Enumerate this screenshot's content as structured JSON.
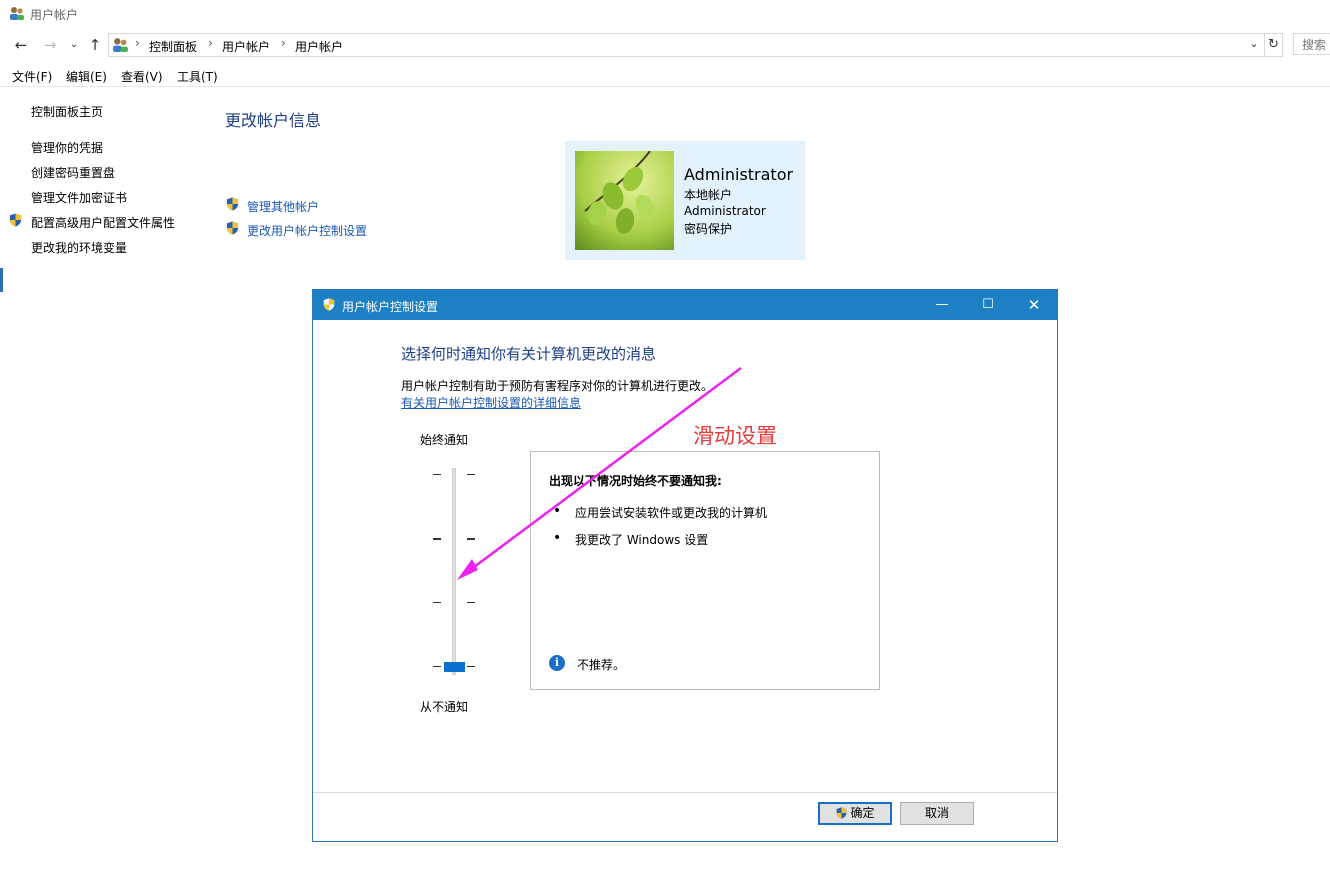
{
  "window": {
    "title": "用户帐户"
  },
  "nav": {
    "breadcrumb": [
      "控制面板",
      "用户帐户",
      "用户帐户"
    ],
    "search_placeholder": "搜索"
  },
  "menu": [
    "文件(F)",
    "编辑(E)",
    "查看(V)",
    "工具(T)"
  ],
  "sidebar": {
    "home": "控制面板主页",
    "items": [
      "管理你的凭据",
      "创建密码重置盘",
      "管理文件加密证书",
      "配置高级用户配置文件属性",
      "更改我的环境变量"
    ]
  },
  "main": {
    "title": "更改帐户信息",
    "tasks": [
      "管理其他帐户",
      "更改用户帐户控制设置"
    ],
    "user": {
      "name": "Administrator",
      "lines": [
        "本地帐户",
        "Administrator",
        "密码保护"
      ]
    }
  },
  "dialog": {
    "title": "用户帐户控制设置",
    "heading": "选择何时通知你有关计算机更改的消息",
    "description": "用户帐户控制有助于预防有害程序对你的计算机进行更改。",
    "link": "有关用户帐户控制设置的详细信息",
    "slider": {
      "top_label": "始终通知",
      "bottom_label": "从不通知",
      "levels": 4,
      "selected_level": 1
    },
    "info": {
      "heading": "出现以下情况时始终不要通知我:",
      "bullets": [
        "应用尝试安装软件或更改我的计算机",
        "我更改了 Windows 设置"
      ],
      "note": "不推荐。"
    },
    "ok": "确定",
    "cancel": "取消"
  },
  "annotation": {
    "text": "滑动设置",
    "color": "#e53b3b",
    "arrow_color": "#ee22ee"
  },
  "colors": {
    "accent": "#1d7fc4",
    "link": "#1a57b8",
    "heading": "#1e3f8a",
    "user_card": "#e3f2fc"
  }
}
